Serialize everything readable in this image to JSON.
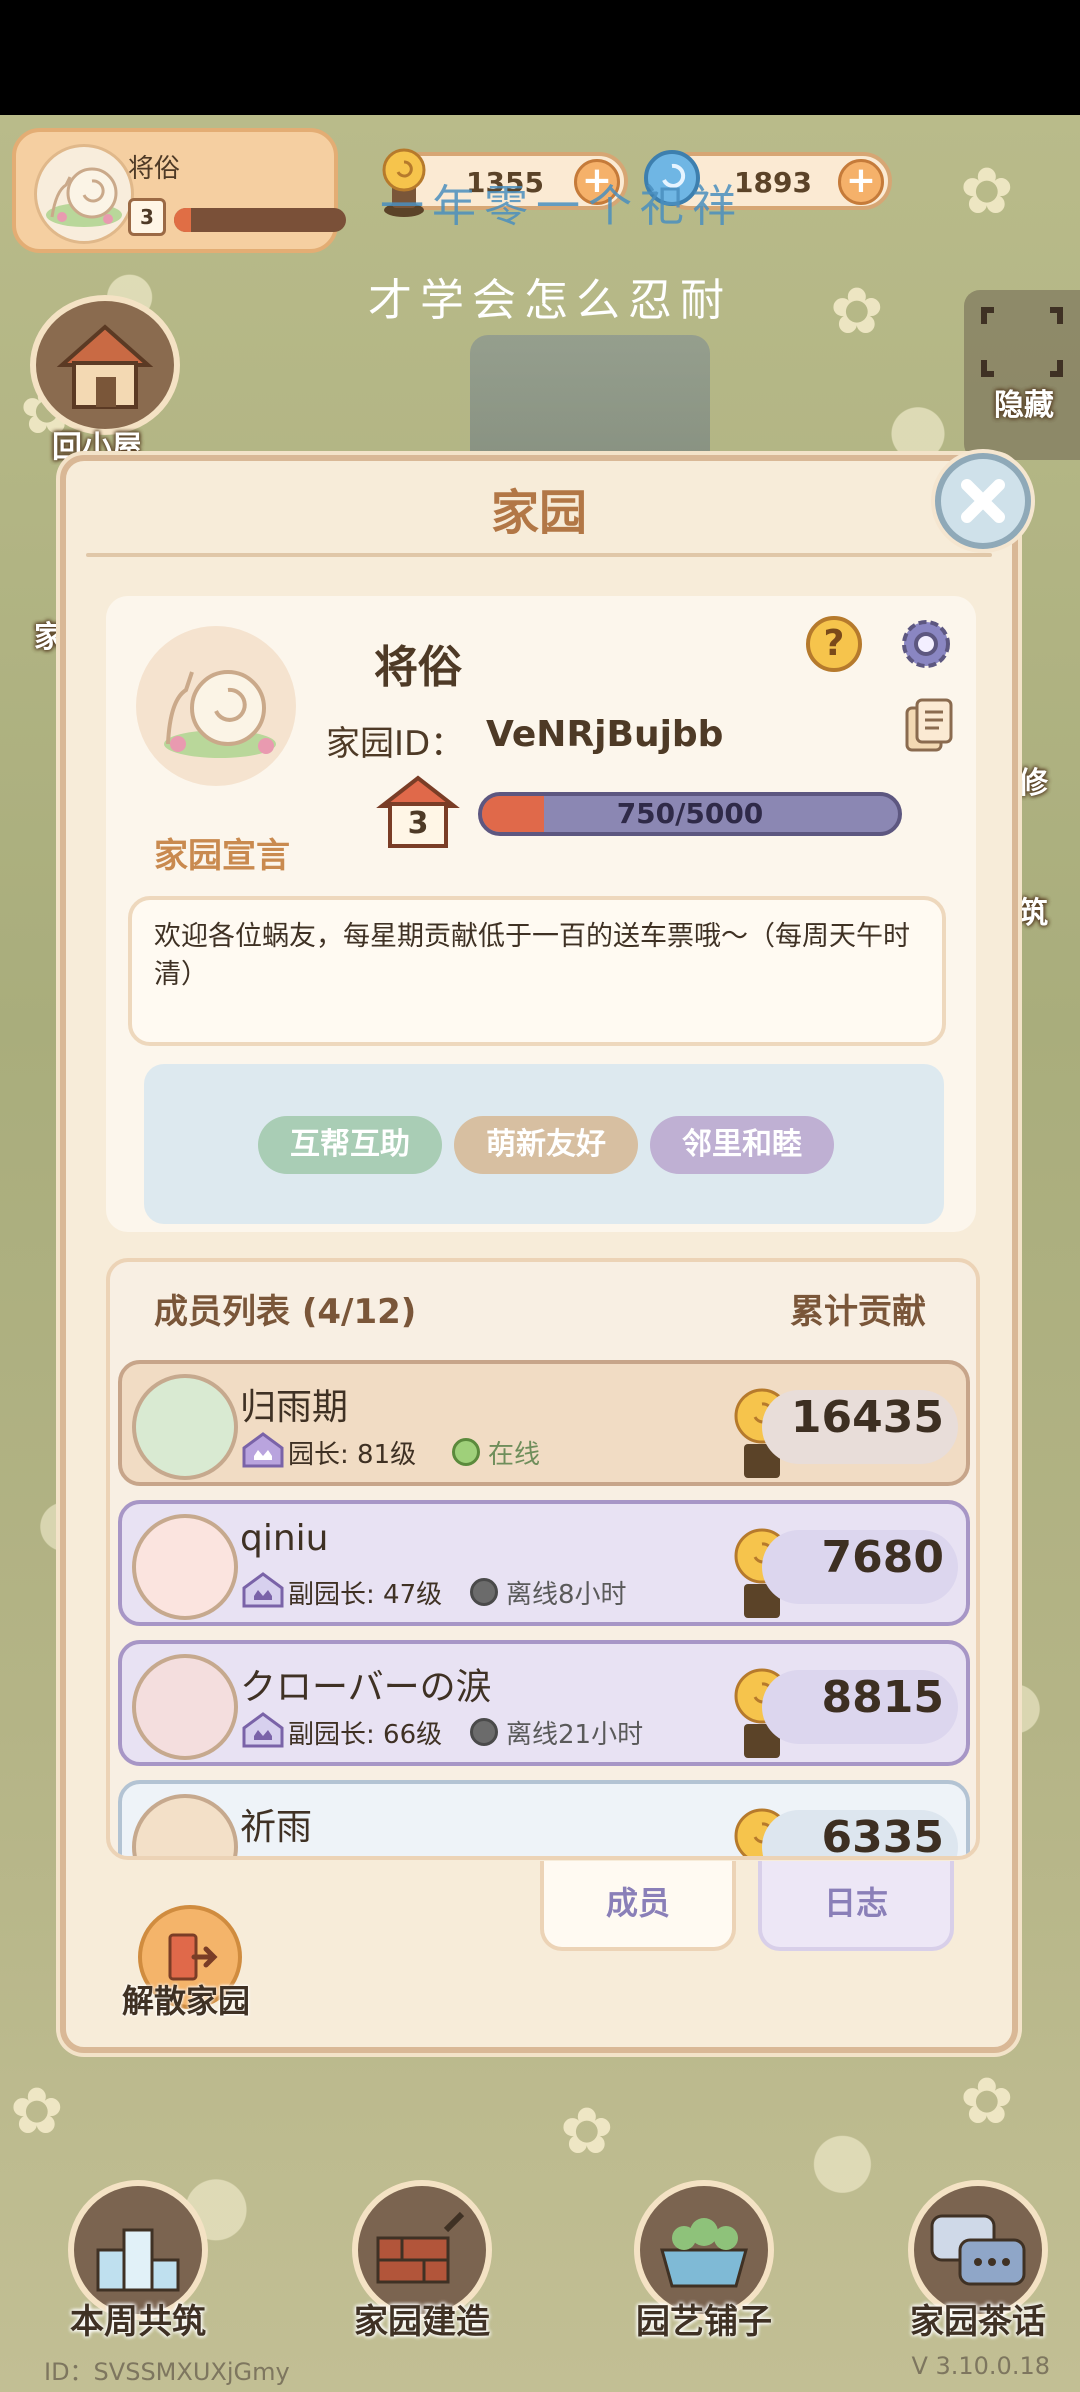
{
  "profile": {
    "name": "将俗",
    "level": "3",
    "progress": 0.1
  },
  "currencies": [
    {
      "value": "1355"
    },
    {
      "value": "1893"
    }
  ],
  "overlay": {
    "line1": "一年零一个祀祥",
    "line2": "才学会怎么忍耐"
  },
  "side": {
    "home_label": "回小屋",
    "hide_label": "隐藏",
    "left_cut": "家",
    "right_cut1": "修",
    "right_cut2": "筑"
  },
  "panel": {
    "title": "家园",
    "home_name": "将俗",
    "id_label": "家园ID：",
    "id_value": "VeNRjBujbb",
    "level": "3",
    "exp_text": "750/5000",
    "exp_fraction": 0.15,
    "declaration_label": "家园宣言",
    "declaration": "欢迎各位蜗友，每星期贡献低于一百的送车票哦～（每周天午时清）",
    "tags": [
      {
        "label": "互帮互助",
        "color": "#a9cdb5"
      },
      {
        "label": "萌新友好",
        "color": "#d7bfa1"
      },
      {
        "label": "邻里和睦",
        "color": "#bfb0d3"
      }
    ],
    "members_title": "成员列表 (4/12)",
    "contrib_title": "累计贡献",
    "members": [
      {
        "name": "归雨期",
        "role": "园长: 81级",
        "status": "在线",
        "online": true,
        "score": "16435"
      },
      {
        "name": "qiniu",
        "role": "副园长: 47级",
        "status": "离线8小时",
        "online": false,
        "score": "7680"
      },
      {
        "name": "クローバーの涙",
        "role": "副园长: 66级",
        "status": "离线21小时",
        "online": false,
        "score": "8815"
      },
      {
        "name": "祈雨",
        "role": "",
        "status": "",
        "online": false,
        "score": "6335"
      }
    ],
    "tab_members": "成员",
    "tab_log": "日志",
    "dissolve_label": "解散家园"
  },
  "nav": [
    {
      "label": "本周共筑"
    },
    {
      "label": "家园建造"
    },
    {
      "label": "园艺铺子"
    },
    {
      "label": "家园茶话"
    }
  ],
  "footer": {
    "id": "ID：SVSSMXUXjGmy",
    "version": "V 3.10.0.18"
  },
  "colors": {
    "accent": "#b27746",
    "online": "#9fd07a",
    "offline": "#6b6b6b"
  }
}
